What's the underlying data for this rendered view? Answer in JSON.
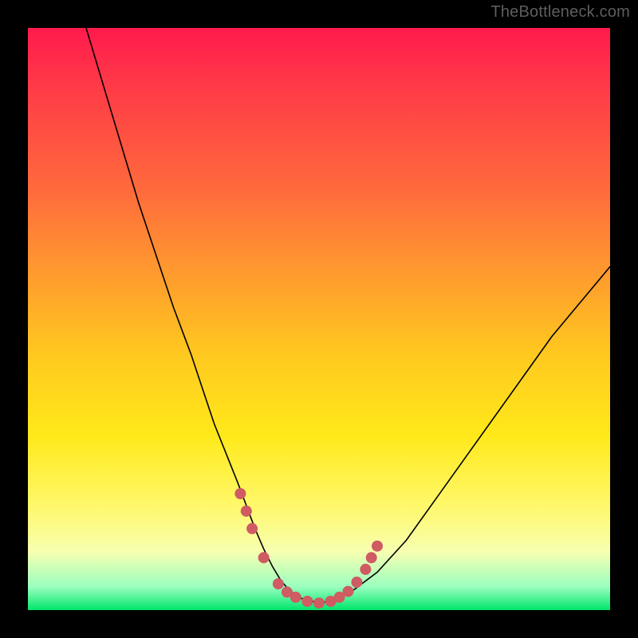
{
  "watermark": "TheBottleneck.com",
  "colors": {
    "background_frame": "#000000",
    "gradient_top": "#ff1a4d",
    "gradient_bottom": "#00e66b",
    "curve_stroke": "#000000",
    "dot_fill": "#cf5b63"
  },
  "chart_data": {
    "type": "line",
    "title": "",
    "xlabel": "",
    "ylabel": "",
    "xlim": [
      0,
      100
    ],
    "ylim": [
      0,
      100
    ],
    "grid": false,
    "legend": false,
    "series": [
      {
        "name": "bottleneck-curve",
        "x": [
          10,
          13,
          16,
          19,
          22,
          25,
          28,
          30,
          32,
          34,
          36,
          37.5,
          39,
          40.5,
          42,
          43.5,
          45,
          47,
          50,
          53,
          56,
          60,
          65,
          70,
          75,
          80,
          85,
          90,
          95,
          100
        ],
        "y": [
          100,
          90,
          80,
          70,
          61,
          52,
          44,
          38,
          32,
          27,
          22,
          18,
          14,
          10.5,
          7.5,
          5,
          3.3,
          2.0,
          1.2,
          1.8,
          3.5,
          6.5,
          12,
          19,
          26,
          33,
          40,
          47,
          53,
          59
        ]
      }
    ],
    "markers": {
      "name": "highlight-dots",
      "points": [
        {
          "x": 36.5,
          "y": 20
        },
        {
          "x": 37.5,
          "y": 17
        },
        {
          "x": 38.5,
          "y": 14
        },
        {
          "x": 40.5,
          "y": 9
        },
        {
          "x": 43,
          "y": 4.5
        },
        {
          "x": 44.5,
          "y": 3.1
        },
        {
          "x": 46,
          "y": 2.2
        },
        {
          "x": 48,
          "y": 1.5
        },
        {
          "x": 50,
          "y": 1.2
        },
        {
          "x": 52,
          "y": 1.5
        },
        {
          "x": 53.5,
          "y": 2.2
        },
        {
          "x": 55,
          "y": 3.2
        },
        {
          "x": 56.5,
          "y": 4.8
        },
        {
          "x": 58,
          "y": 7.0
        },
        {
          "x": 59,
          "y": 9.0
        },
        {
          "x": 60,
          "y": 11.0
        }
      ],
      "radius_px": 7
    }
  }
}
